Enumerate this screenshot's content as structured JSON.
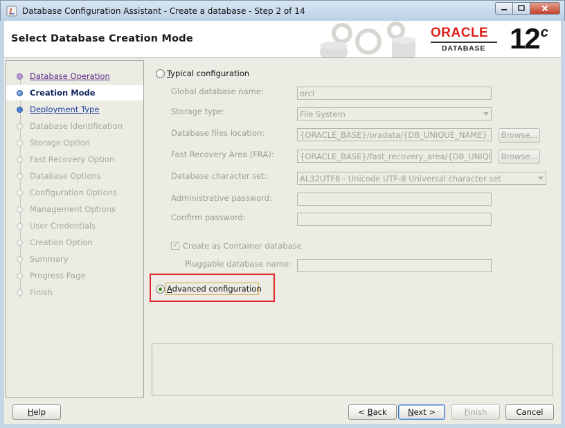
{
  "window": {
    "title": "Database Configuration Assistant - Create a database - Step 2 of 14",
    "minimize_glyph": "▭",
    "maximize_glyph": "▭",
    "close_glyph": "✕"
  },
  "header": {
    "page_title": "Select Database Creation Mode",
    "logo_word": "ORACLE",
    "logo_sub": "DATABASE",
    "version": "12",
    "version_suffix": "c"
  },
  "sidebar": {
    "steps": [
      {
        "label": "Database Operation",
        "state": "visited"
      },
      {
        "label": "Creation Mode",
        "state": "current"
      },
      {
        "label": "Deployment Type",
        "state": "link"
      },
      {
        "label": "Database Identification",
        "state": "disabled"
      },
      {
        "label": "Storage Option",
        "state": "disabled"
      },
      {
        "label": "Fast Recovery Option",
        "state": "disabled"
      },
      {
        "label": "Database Options",
        "state": "disabled"
      },
      {
        "label": "Configuration Options",
        "state": "disabled"
      },
      {
        "label": "Management Options",
        "state": "disabled"
      },
      {
        "label": "User Credentials",
        "state": "disabled"
      },
      {
        "label": "Creation Option",
        "state": "disabled"
      },
      {
        "label": "Summary",
        "state": "disabled"
      },
      {
        "label": "Progress Page",
        "state": "disabled"
      },
      {
        "label": "Finish",
        "state": "disabled"
      }
    ]
  },
  "main": {
    "typical": {
      "label_pre": "",
      "label_mn": "T",
      "label_post": "ypical configuration",
      "selected": false
    },
    "fields": {
      "global_db_name": {
        "label": "Global database name:",
        "value": "orcl"
      },
      "storage_type": {
        "label": "Storage type:",
        "value": "File System"
      },
      "db_files_location": {
        "label": "Database files location:",
        "value": "{ORACLE_BASE}/oradata/{DB_UNIQUE_NAME}",
        "browse": "Browse..."
      },
      "fra": {
        "label": "Fast Recovery Area (FRA):",
        "value": "{ORACLE_BASE}/fast_recovery_area/{DB_UNIQUE_NAME}",
        "browse": "Browse..."
      },
      "charset": {
        "label": "Database character set:",
        "value": "AL32UTF8 - Unicode UTF-8 Universal character set"
      },
      "admin_password": {
        "label": "Administrative password:",
        "value": ""
      },
      "confirm_password": {
        "label": "Confirm password:",
        "value": ""
      },
      "container_db": {
        "label": "Create as Container database",
        "checked": true
      },
      "pluggable_name": {
        "label": "Pluggable database name:",
        "value": ""
      }
    },
    "advanced": {
      "label_pre": "",
      "label_mn": "A",
      "label_post": "dvanced configuration",
      "selected": true
    }
  },
  "footer": {
    "help_mn": "H",
    "help_rest": "elp",
    "back_pre": "< ",
    "back_mn": "B",
    "back_rest": "ack",
    "next_mn": "N",
    "next_rest": "ext >",
    "finish_mn": "F",
    "finish_rest": "inish",
    "cancel": "Cancel"
  },
  "colors": {
    "oracle_red": "#e0201a",
    "highlight_red": "#e0292a",
    "radio_selected": "#3c8b22"
  }
}
